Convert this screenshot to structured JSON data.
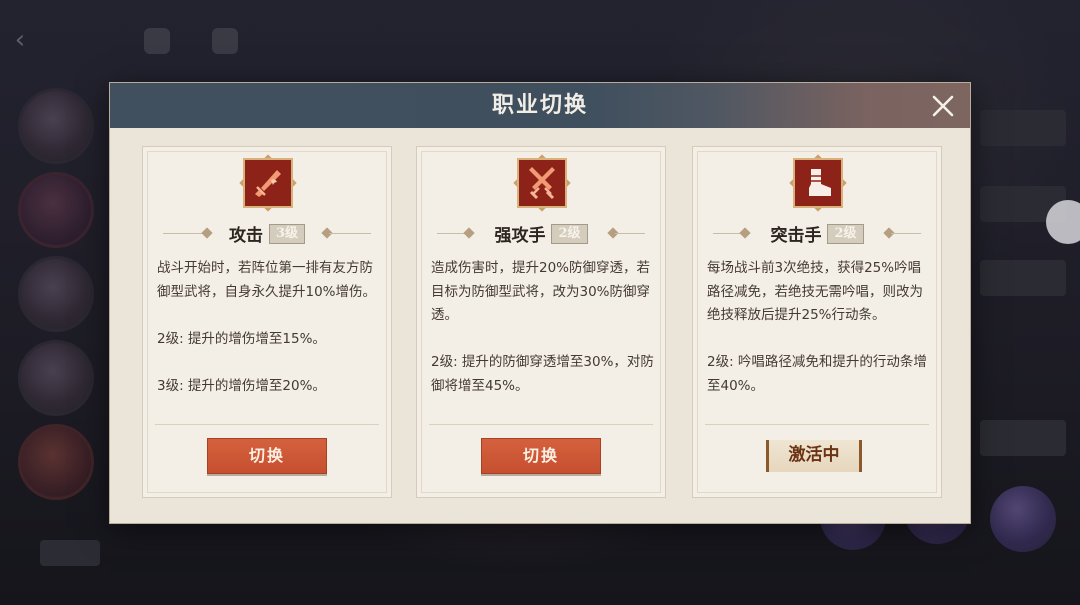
{
  "dialog": {
    "title": "职业切换",
    "close_icon": "close-icon"
  },
  "classes": [
    {
      "name": "攻击",
      "level": "3级",
      "icon": "flaming-sword-icon",
      "description": "战斗开始时，若阵位第一排有友方防御型武将，自身永久提升10%增伤。\n\n2级: 提升的增伤增至15%。\n\n3级: 提升的增伤增至20%。",
      "action": "切换"
    },
    {
      "name": "强攻手",
      "level": "2级",
      "icon": "crossed-swords-icon",
      "description": "造成伤害时，提升20%防御穿透，若目标为防御型武将，改为30%防御穿透。\n\n2级: 提升的防御穿透增至30%，对防御将增至45%。",
      "action": "切换"
    },
    {
      "name": "突击手",
      "level": "2级",
      "icon": "boot-icon",
      "description": "每场战斗前3次绝技，获得25%吟唱路径减免，若绝技无需吟唱，则改为绝技释放后提升25%行动条。\n\n2级: 吟唱路径减免和提升的行动条增至40%。",
      "status": "激活中"
    }
  ],
  "colors": {
    "header_bg": "#41505e",
    "panel_bg": "#ebe4d8",
    "button_bg": "#d4613e",
    "emblem_bg": "#8d2219"
  }
}
